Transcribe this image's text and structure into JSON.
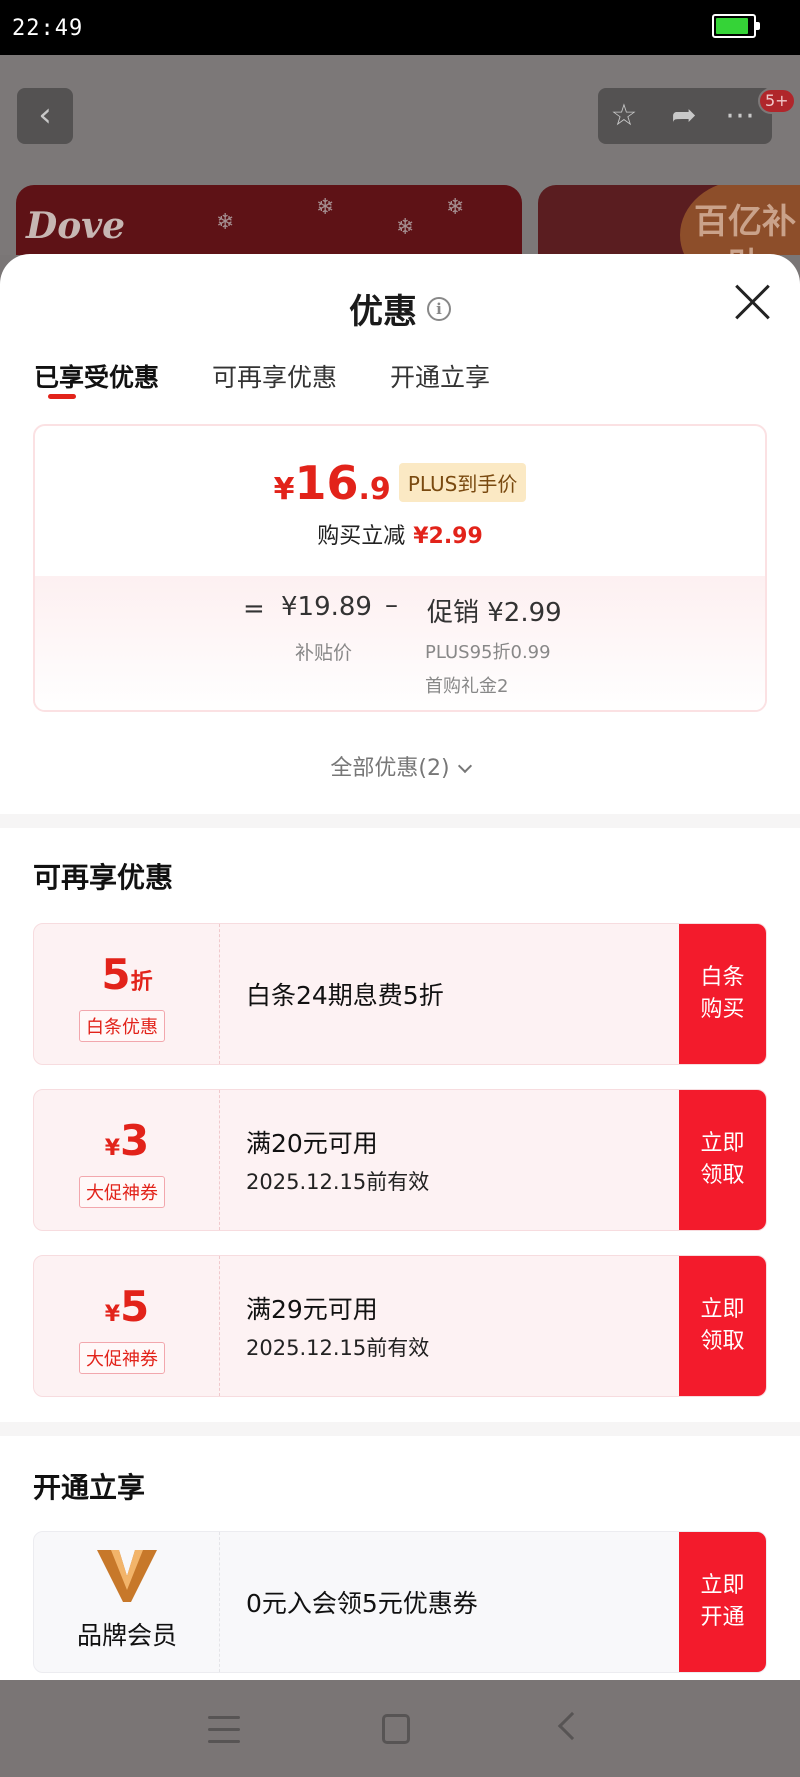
{
  "status_bar": {
    "time": "22:49"
  },
  "background_page": {
    "badge": "5+",
    "banner_logo": "Dove",
    "banner2_tag": "百亿补贴"
  },
  "sheet": {
    "title": "优惠",
    "tabs": [
      {
        "label": "已享受优惠",
        "active": true
      },
      {
        "label": "可再享优惠",
        "active": false
      },
      {
        "label": "开通立享",
        "active": false
      }
    ],
    "enjoyed": {
      "price_symbol": "¥",
      "price_int": "16",
      "price_dec": ".9",
      "price_tag": "PLUS到手价",
      "reduce_label": "购买立减",
      "reduce_amount": "¥2.99",
      "eq": "=",
      "base_price": "¥19.89",
      "minus": "–",
      "promo": "促销 ¥2.99",
      "base_label": "补贴价",
      "promo_detail_1": "PLUS95折0.99",
      "promo_detail_2": "首购礼金2"
    },
    "all_offers": "全部优惠(2)",
    "more_section": {
      "title": "可再享优惠",
      "coupons": [
        {
          "value": "5",
          "unit": "折",
          "prefix": "",
          "tag": "白条优惠",
          "line1": "白条24期息费5折",
          "line2": "",
          "button": "白条购买"
        },
        {
          "value": "3",
          "unit": "",
          "prefix": "¥",
          "tag": "大促神券",
          "line1": "满20元可用",
          "line2": "2025.12.15前有效",
          "button": "立即领取"
        },
        {
          "value": "5",
          "unit": "",
          "prefix": "¥",
          "tag": "大促神券",
          "line1": "满29元可用",
          "line2": "2025.12.15前有效",
          "button": "立即领取"
        }
      ]
    },
    "open_section": {
      "title": "开通立享",
      "member": {
        "name": "品牌会员",
        "desc": "0元入会领5元优惠券",
        "button": "立即开通"
      }
    }
  },
  "colors": {
    "accent": "#e2231a",
    "button": "#f31b2c",
    "battery": "#35d337"
  }
}
